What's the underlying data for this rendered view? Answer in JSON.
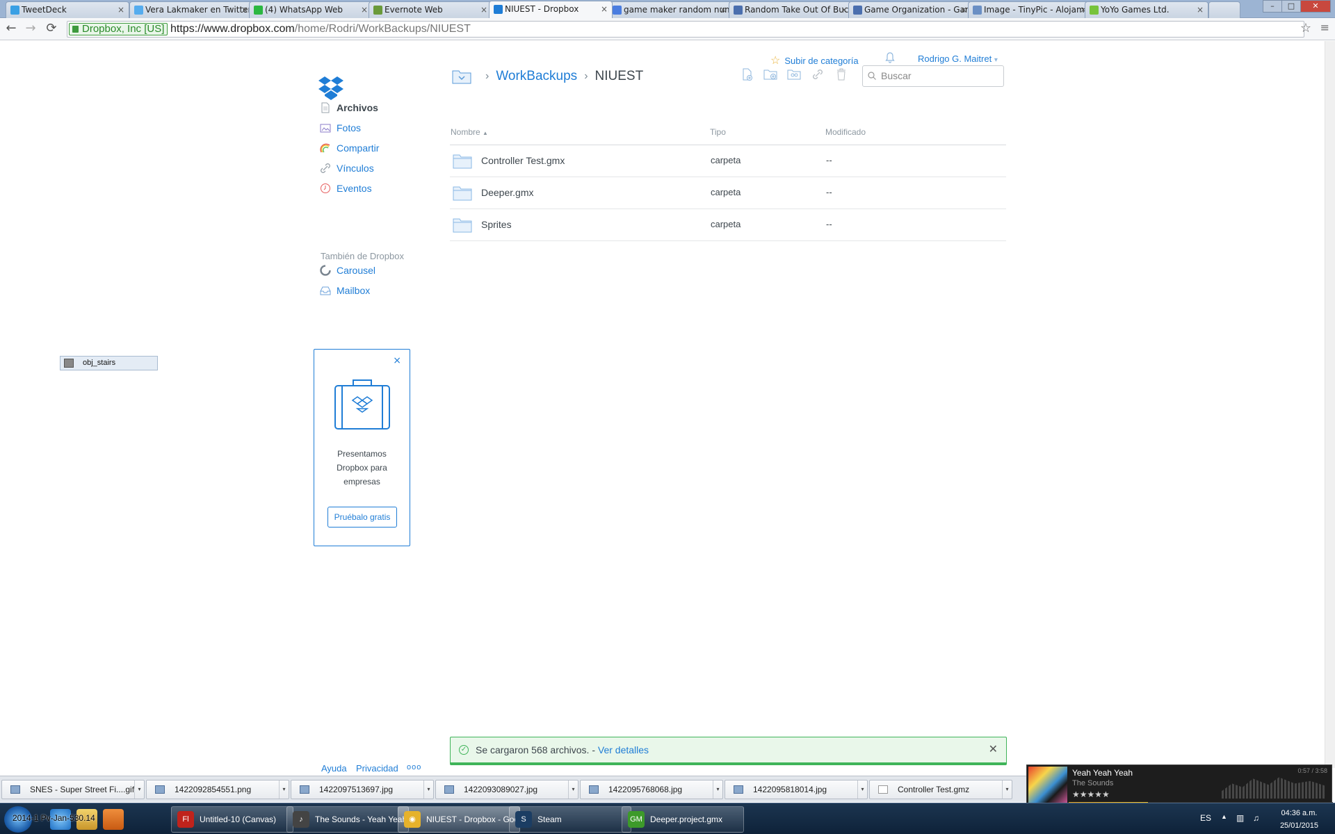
{
  "browser": {
    "tabs": [
      {
        "title": "TweetDeck",
        "fav": "#3aa0e4"
      },
      {
        "title": "Vera Lakmaker en Twitter",
        "fav": "#55acee"
      },
      {
        "title": "(4) WhatsApp Web",
        "fav": "#2bb741"
      },
      {
        "title": "Evernote Web",
        "fav": "#6a9a3a"
      },
      {
        "title": "NIUEST - Dropbox",
        "fav": "#1f7dd6"
      },
      {
        "title": "game maker random number",
        "fav": "#4a7de0"
      },
      {
        "title": "Random Take Out Of Bucket",
        "fav": "#4b6fae"
      },
      {
        "title": "Game Organization - GameMaker",
        "fav": "#4b6fae"
      },
      {
        "title": "Image - TinyPic - Alojamiento",
        "fav": "#6a8fc4"
      },
      {
        "title": "YoYo Games Ltd.",
        "fav": "#77c33b"
      }
    ],
    "ev_label": "Dropbox, Inc [US]",
    "url_host": "https://www.dropbox.com",
    "url_path": "/home/Rodri/WorkBackups/NIUEST",
    "back": "←",
    "forward": "→",
    "reload": "⟳",
    "star": "☆",
    "menu": "≡",
    "win_min": "–",
    "win_max": "□",
    "win_close": "✕",
    "tab_close": "×"
  },
  "header": {
    "upgrade": "Subir de categoría",
    "user": "Rodrigo G. Maitret",
    "user_caret": "▾",
    "breadcrumb": {
      "parent": "WorkBackups",
      "current": "NIUEST",
      "sep": "›"
    },
    "search_placeholder": "Buscar"
  },
  "sidebar": {
    "items": [
      {
        "label": "Archivos",
        "icon": "file-icon",
        "selected": true
      },
      {
        "label": "Fotos",
        "icon": "photos-icon",
        "selected": false
      },
      {
        "label": "Compartir",
        "icon": "share-icon",
        "selected": false
      },
      {
        "label": "Vínculos",
        "icon": "link-icon",
        "selected": false
      },
      {
        "label": "Eventos",
        "icon": "events-icon",
        "selected": false
      }
    ],
    "also_label": "También de Dropbox",
    "also_items": [
      {
        "label": "Carousel",
        "icon": "carousel-icon"
      },
      {
        "label": "Mailbox",
        "icon": "mailbox-icon"
      }
    ]
  },
  "promo": {
    "text_line1": "Presentamos",
    "text_line2": "Dropbox para",
    "text_line3": "empresas",
    "button": "Pruébalo gratis",
    "close": "×"
  },
  "drag_chip": "obj_stairs",
  "table": {
    "headers": {
      "name": "Nombre",
      "type": "Tipo",
      "modified": "Modificado",
      "sort_arrow": "▲"
    },
    "rows": [
      {
        "name": "Controller Test.gmx",
        "type": "carpeta",
        "modified": "--"
      },
      {
        "name": "Deeper.gmx",
        "type": "carpeta",
        "modified": "--"
      },
      {
        "name": "Sprites",
        "type": "carpeta",
        "modified": "--"
      }
    ]
  },
  "notification": {
    "text": "Se cargaron 568 archivos. - ",
    "link": "Ver detalles",
    "check": "✓",
    "close": "✕"
  },
  "footer": {
    "help": "Ayuda",
    "privacy": "Privacidad",
    "more": "ooo"
  },
  "downloads": [
    "SNES - Super Street Fi....gif",
    "1422092854551.png",
    "1422097513697.jpg",
    "1422093089027.jpg",
    "1422095768068.jpg",
    "1422095818014.jpg",
    "Controller Test.gmz"
  ],
  "download_caret": "▾",
  "music": {
    "title": "Yeah Yeah Yeah",
    "artist": "The Sounds",
    "time": "0:57 / 3:58",
    "rating": "★★★★★",
    "progress": 0.3
  },
  "taskbar": {
    "buttons": [
      {
        "label": "Untitled-10 (Canvas)",
        "color": "#c0231c",
        "glyph": "Fl"
      },
      {
        "label": "The Sounds - Yeah Yeah Yeah",
        "color": "#444",
        "glyph": "♪"
      },
      {
        "label": "NIUEST - Dropbox - Google Chrome",
        "color": "#e6b22b",
        "glyph": "◉"
      },
      {
        "label": "Steam",
        "color": "#1b3d63",
        "glyph": "S"
      },
      {
        "label": "Deeper.project.gmx",
        "color": "#3d9a2a",
        "glyph": "GM"
      }
    ],
    "overlay_text": "2014-1 Pv-Jan-530.14",
    "lang": "ES",
    "tray_up": "▲",
    "time": "04:36 a.m.",
    "date": "25/01/2015"
  }
}
